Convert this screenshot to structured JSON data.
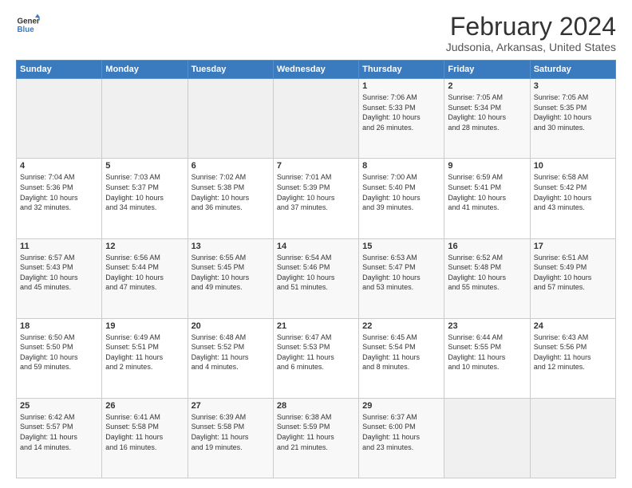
{
  "logo": {
    "general": "General",
    "blue": "Blue"
  },
  "header": {
    "month": "February 2024",
    "location": "Judsonia, Arkansas, United States"
  },
  "weekdays": [
    "Sunday",
    "Monday",
    "Tuesday",
    "Wednesday",
    "Thursday",
    "Friday",
    "Saturday"
  ],
  "weeks": [
    [
      {
        "day": "",
        "info": ""
      },
      {
        "day": "",
        "info": ""
      },
      {
        "day": "",
        "info": ""
      },
      {
        "day": "",
        "info": ""
      },
      {
        "day": "1",
        "info": "Sunrise: 7:06 AM\nSunset: 5:33 PM\nDaylight: 10 hours\nand 26 minutes."
      },
      {
        "day": "2",
        "info": "Sunrise: 7:05 AM\nSunset: 5:34 PM\nDaylight: 10 hours\nand 28 minutes."
      },
      {
        "day": "3",
        "info": "Sunrise: 7:05 AM\nSunset: 5:35 PM\nDaylight: 10 hours\nand 30 minutes."
      }
    ],
    [
      {
        "day": "4",
        "info": "Sunrise: 7:04 AM\nSunset: 5:36 PM\nDaylight: 10 hours\nand 32 minutes."
      },
      {
        "day": "5",
        "info": "Sunrise: 7:03 AM\nSunset: 5:37 PM\nDaylight: 10 hours\nand 34 minutes."
      },
      {
        "day": "6",
        "info": "Sunrise: 7:02 AM\nSunset: 5:38 PM\nDaylight: 10 hours\nand 36 minutes."
      },
      {
        "day": "7",
        "info": "Sunrise: 7:01 AM\nSunset: 5:39 PM\nDaylight: 10 hours\nand 37 minutes."
      },
      {
        "day": "8",
        "info": "Sunrise: 7:00 AM\nSunset: 5:40 PM\nDaylight: 10 hours\nand 39 minutes."
      },
      {
        "day": "9",
        "info": "Sunrise: 6:59 AM\nSunset: 5:41 PM\nDaylight: 10 hours\nand 41 minutes."
      },
      {
        "day": "10",
        "info": "Sunrise: 6:58 AM\nSunset: 5:42 PM\nDaylight: 10 hours\nand 43 minutes."
      }
    ],
    [
      {
        "day": "11",
        "info": "Sunrise: 6:57 AM\nSunset: 5:43 PM\nDaylight: 10 hours\nand 45 minutes."
      },
      {
        "day": "12",
        "info": "Sunrise: 6:56 AM\nSunset: 5:44 PM\nDaylight: 10 hours\nand 47 minutes."
      },
      {
        "day": "13",
        "info": "Sunrise: 6:55 AM\nSunset: 5:45 PM\nDaylight: 10 hours\nand 49 minutes."
      },
      {
        "day": "14",
        "info": "Sunrise: 6:54 AM\nSunset: 5:46 PM\nDaylight: 10 hours\nand 51 minutes."
      },
      {
        "day": "15",
        "info": "Sunrise: 6:53 AM\nSunset: 5:47 PM\nDaylight: 10 hours\nand 53 minutes."
      },
      {
        "day": "16",
        "info": "Sunrise: 6:52 AM\nSunset: 5:48 PM\nDaylight: 10 hours\nand 55 minutes."
      },
      {
        "day": "17",
        "info": "Sunrise: 6:51 AM\nSunset: 5:49 PM\nDaylight: 10 hours\nand 57 minutes."
      }
    ],
    [
      {
        "day": "18",
        "info": "Sunrise: 6:50 AM\nSunset: 5:50 PM\nDaylight: 10 hours\nand 59 minutes."
      },
      {
        "day": "19",
        "info": "Sunrise: 6:49 AM\nSunset: 5:51 PM\nDaylight: 11 hours\nand 2 minutes."
      },
      {
        "day": "20",
        "info": "Sunrise: 6:48 AM\nSunset: 5:52 PM\nDaylight: 11 hours\nand 4 minutes."
      },
      {
        "day": "21",
        "info": "Sunrise: 6:47 AM\nSunset: 5:53 PM\nDaylight: 11 hours\nand 6 minutes."
      },
      {
        "day": "22",
        "info": "Sunrise: 6:45 AM\nSunset: 5:54 PM\nDaylight: 11 hours\nand 8 minutes."
      },
      {
        "day": "23",
        "info": "Sunrise: 6:44 AM\nSunset: 5:55 PM\nDaylight: 11 hours\nand 10 minutes."
      },
      {
        "day": "24",
        "info": "Sunrise: 6:43 AM\nSunset: 5:56 PM\nDaylight: 11 hours\nand 12 minutes."
      }
    ],
    [
      {
        "day": "25",
        "info": "Sunrise: 6:42 AM\nSunset: 5:57 PM\nDaylight: 11 hours\nand 14 minutes."
      },
      {
        "day": "26",
        "info": "Sunrise: 6:41 AM\nSunset: 5:58 PM\nDaylight: 11 hours\nand 16 minutes."
      },
      {
        "day": "27",
        "info": "Sunrise: 6:39 AM\nSunset: 5:58 PM\nDaylight: 11 hours\nand 19 minutes."
      },
      {
        "day": "28",
        "info": "Sunrise: 6:38 AM\nSunset: 5:59 PM\nDaylight: 11 hours\nand 21 minutes."
      },
      {
        "day": "29",
        "info": "Sunrise: 6:37 AM\nSunset: 6:00 PM\nDaylight: 11 hours\nand 23 minutes."
      },
      {
        "day": "",
        "info": ""
      },
      {
        "day": "",
        "info": ""
      }
    ]
  ]
}
